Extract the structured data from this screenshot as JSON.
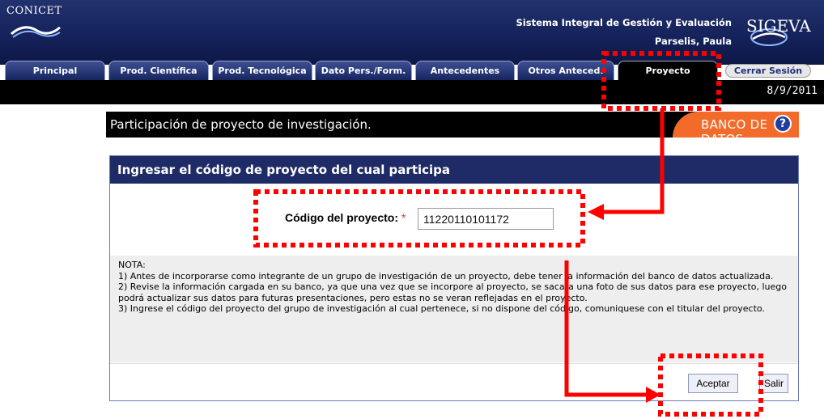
{
  "header": {
    "logo_left": "CONICET",
    "system_title": "Sistema Integral de Gestión y Evaluación",
    "user_name": "Parselis, Paula",
    "logo_right": "SIGEVA"
  },
  "tabs": [
    {
      "label": "Principal"
    },
    {
      "label": "Prod. Científica"
    },
    {
      "label": "Prod. Tecnológica"
    },
    {
      "label": "Dato Pers./Form."
    },
    {
      "label": "Antecedentes"
    },
    {
      "label": "Otros Anteced."
    },
    {
      "label": "Proyecto",
      "active": true
    }
  ],
  "logout_label": "Cerrar Sesión",
  "date": "8/9/2011",
  "page_title": "Participación de proyecto de investigación.",
  "banner_text": "BANCO DE DATOS",
  "help_icon": "question-circle-icon",
  "panel": {
    "heading": "Ingresar el código de proyecto del cual participa",
    "code_label": "Código del proyecto:",
    "required_mark": "*",
    "code_value": "11220110101172",
    "note": {
      "title": "NOTA:",
      "lines": [
        "1) Antes de incorporarse como integrante de un grupo de investigación de un proyecto, debe tener la información del banco de datos actualizada.",
        "2) Revise la información cargada en su banco, ya que una vez que se incorpore al proyecto, se sacara una foto de sus datos para ese proyecto, luego podrá actualizar sus datos para futuras presentaciones, pero estas no se veran reflejadas en el proyecto.",
        "3) Ingrese el código del proyecto del grupo de investigación al cual pertenece, si no dispone del código, comuniquese con el titular del proyecto."
      ]
    },
    "accept_label": "Aceptar",
    "exit_label": "Salir"
  },
  "colors": {
    "header_navy": "#14215a",
    "banner_orange": "#f26b2a",
    "annotation_red": "#ff0000"
  }
}
